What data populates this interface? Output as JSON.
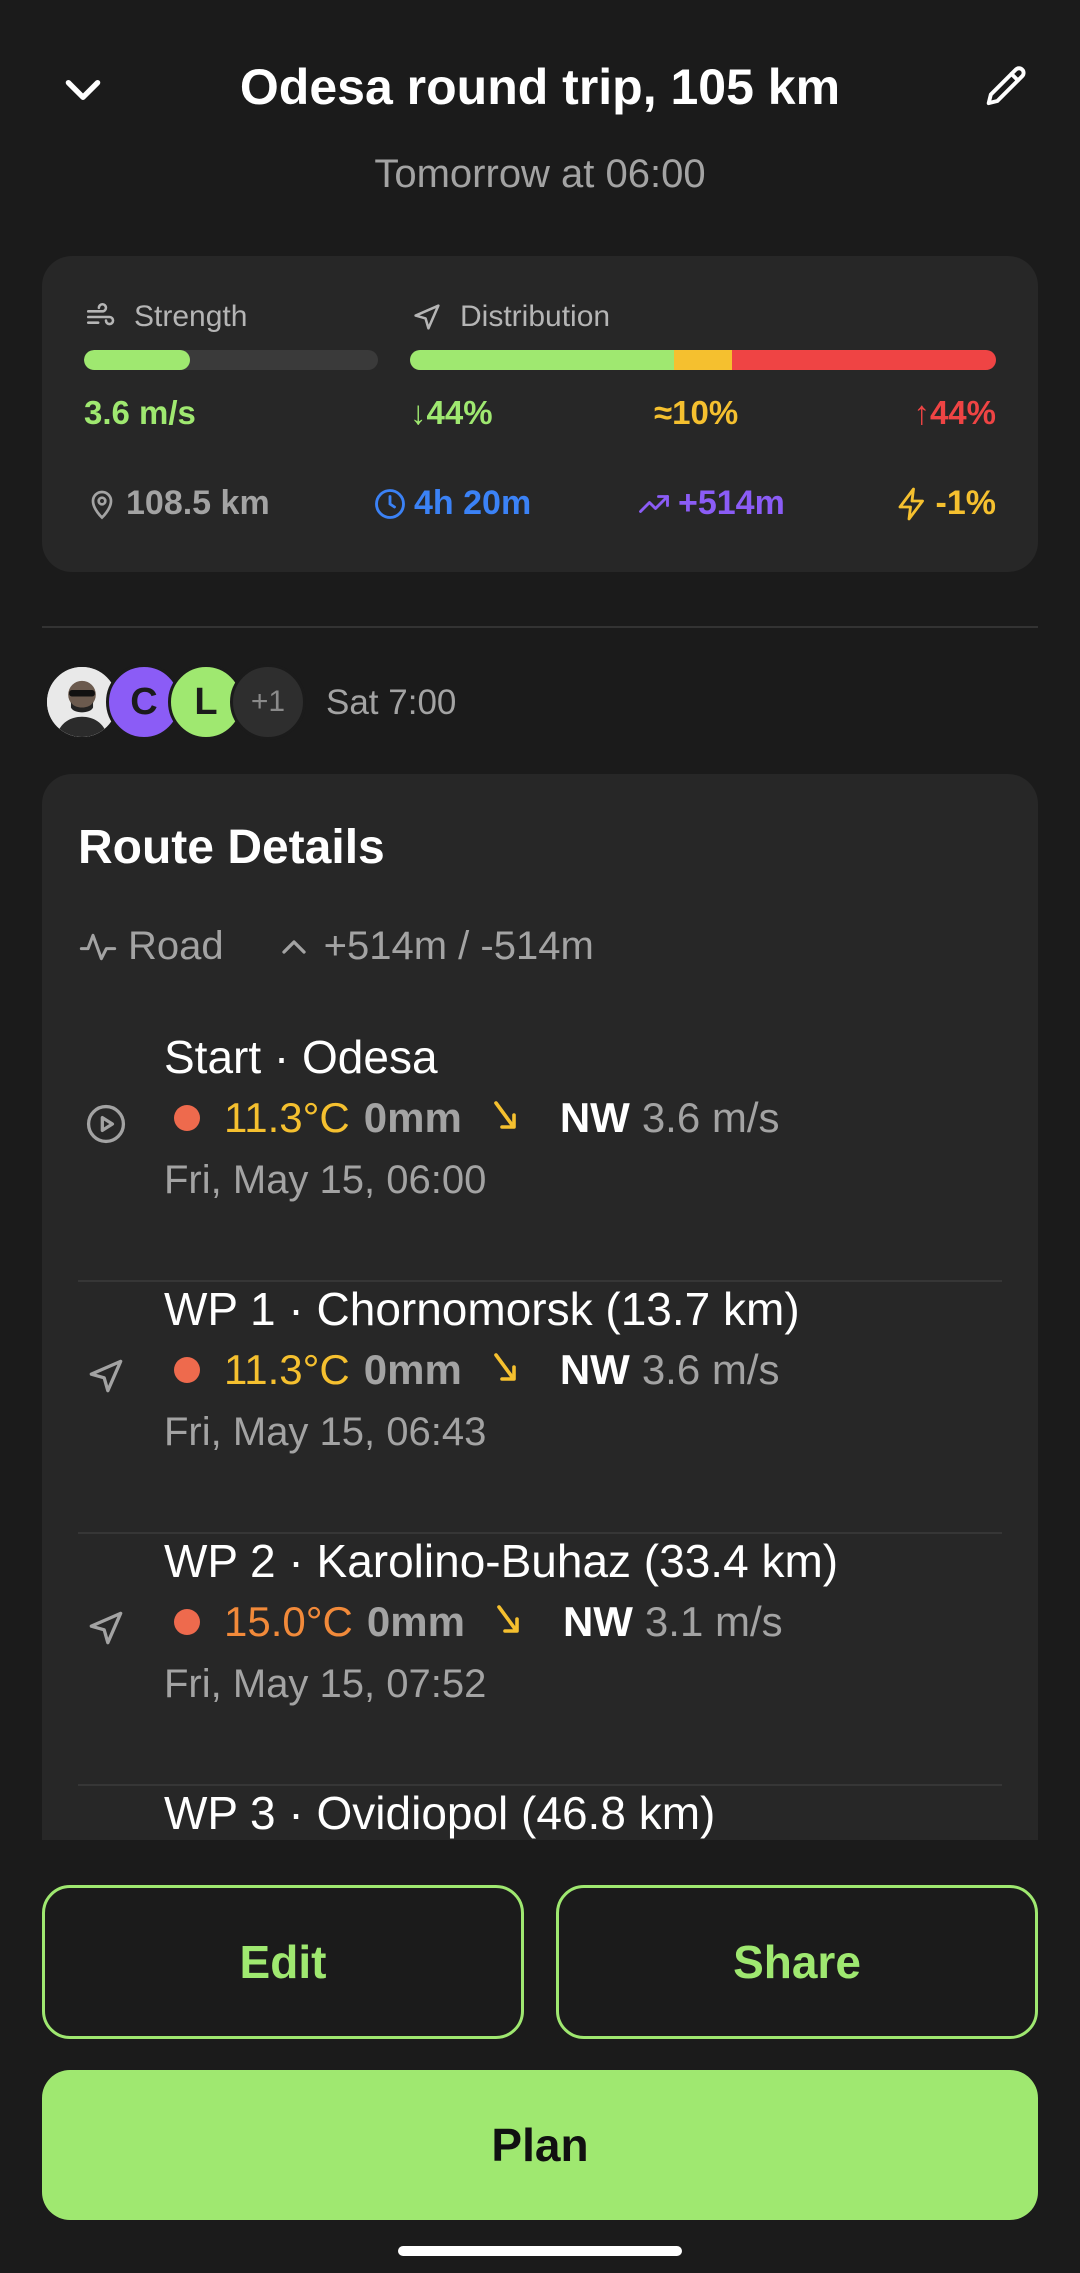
{
  "header": {
    "title": "Odesa round trip, 105 km",
    "subtitle": "Tomorrow at 06:00"
  },
  "summary": {
    "strength_label": "Strength",
    "strength_value": "3.6 m/s",
    "strength_level": 0.36,
    "distribution_label": "Distribution",
    "distribution": [
      {
        "label": "↓44%",
        "fraction": 0.45,
        "color": "#9fe870"
      },
      {
        "label": "≈10%",
        "fraction": 0.1,
        "color": "#f5c02f"
      },
      {
        "label": "↑44%",
        "fraction": 0.45,
        "color": "#ef4444"
      }
    ],
    "stats": {
      "distance": "108.5 km",
      "duration": "4h 20m",
      "elevation": "+514m",
      "energy": "-1%"
    }
  },
  "participants": {
    "avatars": [
      {
        "initial": "",
        "color": "#cfcfcf"
      },
      {
        "initial": "C",
        "color": "#8b5cf6"
      },
      {
        "initial": "L",
        "color": "#9fe870"
      }
    ],
    "more": "+1",
    "time": "Sat 7:00"
  },
  "route_details": {
    "title": "Route Details",
    "surface": "Road",
    "elevation": "+514m / -514m",
    "waypoints": [
      {
        "name": "Start · Odesa",
        "temp": "11.3°C",
        "temp_color": "#f5c02f",
        "rain": "0mm",
        "dir": "NW",
        "speed": "3.6 m/s",
        "time": "Fri, May 15, 06:00",
        "icon": "play-icon"
      },
      {
        "name": "WP 1 · Chornomorsk (13.7 km)",
        "temp": "11.3°C",
        "temp_color": "#f5c02f",
        "rain": "0mm",
        "dir": "NW",
        "speed": "3.6 m/s",
        "time": "Fri, May 15, 06:43",
        "icon": "navigation-icon"
      },
      {
        "name": "WP 2 · Karolino-Buhaz (33.4 km)",
        "temp": "15.0°C",
        "temp_color": "#f28a3a",
        "rain": "0mm",
        "dir": "NW",
        "speed": "3.1 m/s",
        "time": "Fri, May 15, 07:52",
        "icon": "navigation-icon"
      },
      {
        "name": "WP 3 · Ovidiopol (46.8 km)",
        "temp": "",
        "temp_color": "#f5c02f",
        "rain": "",
        "dir": "",
        "speed": "",
        "time": "",
        "icon": "navigation-icon"
      }
    ]
  },
  "actions": {
    "edit": "Edit",
    "share": "Share",
    "plan": "Plan"
  },
  "colors": {
    "accent": "#9fe870",
    "blue": "#3b82f6",
    "purple": "#8b5cf6",
    "yellow": "#f5c02f",
    "red": "#ef4444"
  }
}
